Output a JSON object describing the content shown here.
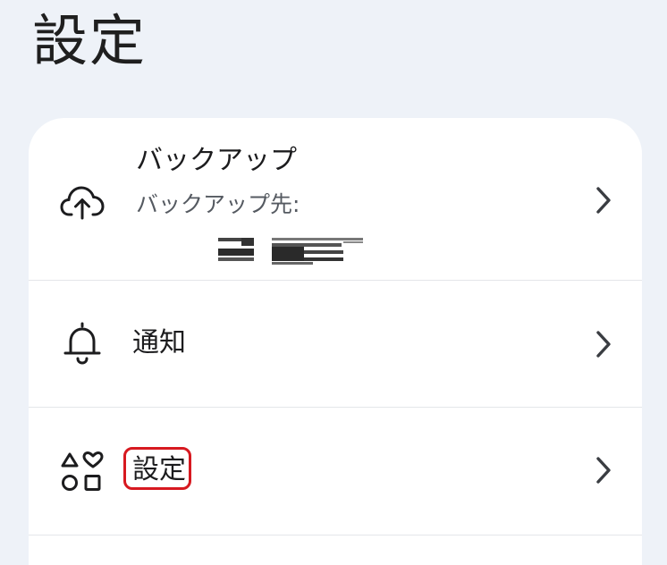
{
  "page": {
    "title": "設定"
  },
  "settings": {
    "items": [
      {
        "id": "backup",
        "label": "バックアップ",
        "subtitle": "バックアップ先:",
        "icon": "cloud-upload-icon"
      },
      {
        "id": "notifications",
        "label": "通知",
        "icon": "bell-icon"
      },
      {
        "id": "settings",
        "label": "設定",
        "icon": "shapes-icon"
      }
    ]
  },
  "annotation": {
    "color": "#d71920"
  },
  "colors": {
    "background": "#eef2f8",
    "card": "#ffffff",
    "divider": "#e4e6ea"
  }
}
